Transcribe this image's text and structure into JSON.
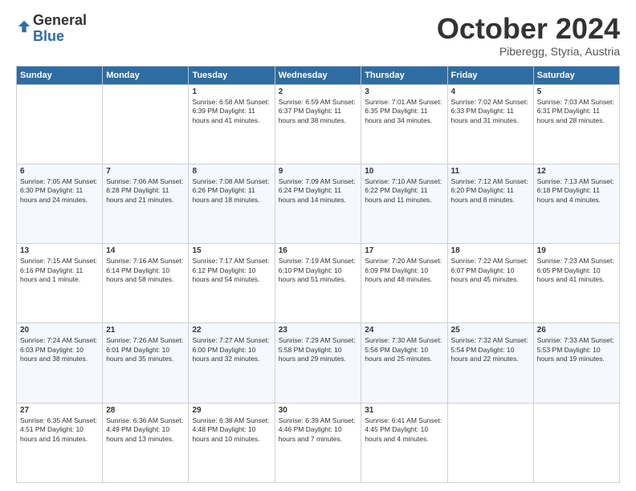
{
  "header": {
    "logo_general": "General",
    "logo_blue": "Blue",
    "month": "October 2024",
    "location": "Piberegg, Styria, Austria"
  },
  "weekdays": [
    "Sunday",
    "Monday",
    "Tuesday",
    "Wednesday",
    "Thursday",
    "Friday",
    "Saturday"
  ],
  "weeks": [
    [
      {
        "day": "",
        "info": ""
      },
      {
        "day": "",
        "info": ""
      },
      {
        "day": "1",
        "info": "Sunrise: 6:58 AM\nSunset: 6:39 PM\nDaylight: 11 hours and 41 minutes."
      },
      {
        "day": "2",
        "info": "Sunrise: 6:59 AM\nSunset: 6:37 PM\nDaylight: 11 hours and 38 minutes."
      },
      {
        "day": "3",
        "info": "Sunrise: 7:01 AM\nSunset: 6:35 PM\nDaylight: 11 hours and 34 minutes."
      },
      {
        "day": "4",
        "info": "Sunrise: 7:02 AM\nSunset: 6:33 PM\nDaylight: 11 hours and 31 minutes."
      },
      {
        "day": "5",
        "info": "Sunrise: 7:03 AM\nSunset: 6:31 PM\nDaylight: 11 hours and 28 minutes."
      }
    ],
    [
      {
        "day": "6",
        "info": "Sunrise: 7:05 AM\nSunset: 6:30 PM\nDaylight: 11 hours and 24 minutes."
      },
      {
        "day": "7",
        "info": "Sunrise: 7:06 AM\nSunset: 6:28 PM\nDaylight: 11 hours and 21 minutes."
      },
      {
        "day": "8",
        "info": "Sunrise: 7:08 AM\nSunset: 6:26 PM\nDaylight: 11 hours and 18 minutes."
      },
      {
        "day": "9",
        "info": "Sunrise: 7:09 AM\nSunset: 6:24 PM\nDaylight: 11 hours and 14 minutes."
      },
      {
        "day": "10",
        "info": "Sunrise: 7:10 AM\nSunset: 6:22 PM\nDaylight: 11 hours and 11 minutes."
      },
      {
        "day": "11",
        "info": "Sunrise: 7:12 AM\nSunset: 6:20 PM\nDaylight: 11 hours and 8 minutes."
      },
      {
        "day": "12",
        "info": "Sunrise: 7:13 AM\nSunset: 6:18 PM\nDaylight: 11 hours and 4 minutes."
      }
    ],
    [
      {
        "day": "13",
        "info": "Sunrise: 7:15 AM\nSunset: 6:16 PM\nDaylight: 11 hours and 1 minute."
      },
      {
        "day": "14",
        "info": "Sunrise: 7:16 AM\nSunset: 6:14 PM\nDaylight: 10 hours and 58 minutes."
      },
      {
        "day": "15",
        "info": "Sunrise: 7:17 AM\nSunset: 6:12 PM\nDaylight: 10 hours and 54 minutes."
      },
      {
        "day": "16",
        "info": "Sunrise: 7:19 AM\nSunset: 6:10 PM\nDaylight: 10 hours and 51 minutes."
      },
      {
        "day": "17",
        "info": "Sunrise: 7:20 AM\nSunset: 6:09 PM\nDaylight: 10 hours and 48 minutes."
      },
      {
        "day": "18",
        "info": "Sunrise: 7:22 AM\nSunset: 6:07 PM\nDaylight: 10 hours and 45 minutes."
      },
      {
        "day": "19",
        "info": "Sunrise: 7:23 AM\nSunset: 6:05 PM\nDaylight: 10 hours and 41 minutes."
      }
    ],
    [
      {
        "day": "20",
        "info": "Sunrise: 7:24 AM\nSunset: 6:03 PM\nDaylight: 10 hours and 38 minutes."
      },
      {
        "day": "21",
        "info": "Sunrise: 7:26 AM\nSunset: 6:01 PM\nDaylight: 10 hours and 35 minutes."
      },
      {
        "day": "22",
        "info": "Sunrise: 7:27 AM\nSunset: 6:00 PM\nDaylight: 10 hours and 32 minutes."
      },
      {
        "day": "23",
        "info": "Sunrise: 7:29 AM\nSunset: 5:58 PM\nDaylight: 10 hours and 29 minutes."
      },
      {
        "day": "24",
        "info": "Sunrise: 7:30 AM\nSunset: 5:56 PM\nDaylight: 10 hours and 25 minutes."
      },
      {
        "day": "25",
        "info": "Sunrise: 7:32 AM\nSunset: 5:54 PM\nDaylight: 10 hours and 22 minutes."
      },
      {
        "day": "26",
        "info": "Sunrise: 7:33 AM\nSunset: 5:53 PM\nDaylight: 10 hours and 19 minutes."
      }
    ],
    [
      {
        "day": "27",
        "info": "Sunrise: 6:35 AM\nSunset: 4:51 PM\nDaylight: 10 hours and 16 minutes."
      },
      {
        "day": "28",
        "info": "Sunrise: 6:36 AM\nSunset: 4:49 PM\nDaylight: 10 hours and 13 minutes."
      },
      {
        "day": "29",
        "info": "Sunrise: 6:38 AM\nSunset: 4:48 PM\nDaylight: 10 hours and 10 minutes."
      },
      {
        "day": "30",
        "info": "Sunrise: 6:39 AM\nSunset: 4:46 PM\nDaylight: 10 hours and 7 minutes."
      },
      {
        "day": "31",
        "info": "Sunrise: 6:41 AM\nSunset: 4:45 PM\nDaylight: 10 hours and 4 minutes."
      },
      {
        "day": "",
        "info": ""
      },
      {
        "day": "",
        "info": ""
      }
    ]
  ]
}
